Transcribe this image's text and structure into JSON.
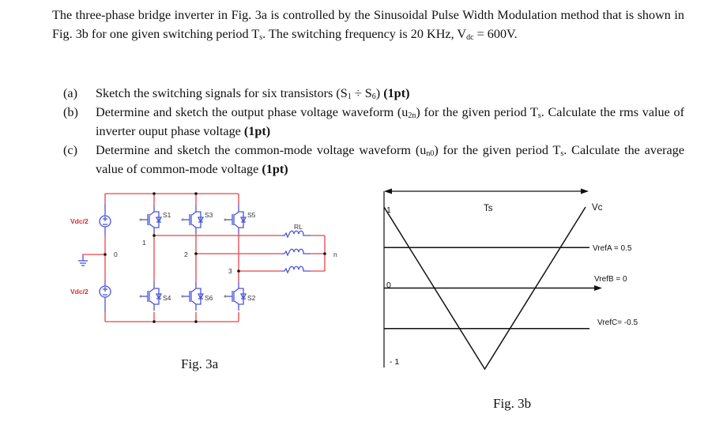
{
  "problem": {
    "intro_parts": [
      "The three-phase bridge inverter in Fig. 3a is controlled by the Sinusoidal Pulse Width Modulation method that is shown in Fig. 3b for one given switching period T",
      "s",
      ". The switching frequency is 20 KHz, V",
      "dc",
      " = 600V."
    ],
    "items": [
      {
        "label": "(a)",
        "text": "Sketch the switching signals for six transistors (S",
        "sub1": "1",
        "mid": " ÷ S",
        "sub2": "6",
        "tail": ") ",
        "points": "(1pt)"
      },
      {
        "label": "(b)",
        "text": "Determine and sketch the output phase voltage waveform (u",
        "sub1": "2n",
        "mid": ") for the given period T",
        "sub2": "s",
        "tail": ". Calculate the rms value of inverter ouput phase voltage ",
        "points": "(1pt)"
      },
      {
        "label": "(c)",
        "text": "Determine and sketch the common-mode voltage waveform (u",
        "sub1": "n0",
        "mid": ") for the given period T",
        "sub2": "s",
        "tail": ". Calculate the average value of common-mode voltage ",
        "points": "(1pt)"
      }
    ]
  },
  "fig3a": {
    "caption": "Fig. 3a",
    "source_top_label": "Vdc/2",
    "source_bottom_label": "Vdc/2",
    "switches_top": [
      "S1",
      "S3",
      "S5"
    ],
    "switches_bottom": [
      "S4",
      "S6",
      "S2"
    ],
    "nodes": [
      "0",
      "1",
      "2",
      "3",
      "n"
    ],
    "load_label": "RL",
    "colors": {
      "wire": "#e8434b",
      "component": "#4a55d6",
      "source_label": "#e0282f"
    }
  },
  "fig3b": {
    "caption": "Fig. 3b",
    "period_label": "Ts",
    "carrier_label": "Vc",
    "axis_ticks": [
      "1",
      "0",
      "- 1"
    ],
    "references": [
      {
        "name": "VrefA",
        "label": "VrefA = 0.5",
        "value": 0.5
      },
      {
        "name": "VrefB",
        "label": "VrefB = 0",
        "value": 0
      },
      {
        "name": "VrefC",
        "label": "VrefC= -0.5",
        "value": -0.5
      }
    ],
    "carrier": {
      "type": "triangle",
      "points": [
        [
          0,
          1
        ],
        [
          0.5,
          -1
        ],
        [
          1,
          1
        ]
      ]
    }
  }
}
